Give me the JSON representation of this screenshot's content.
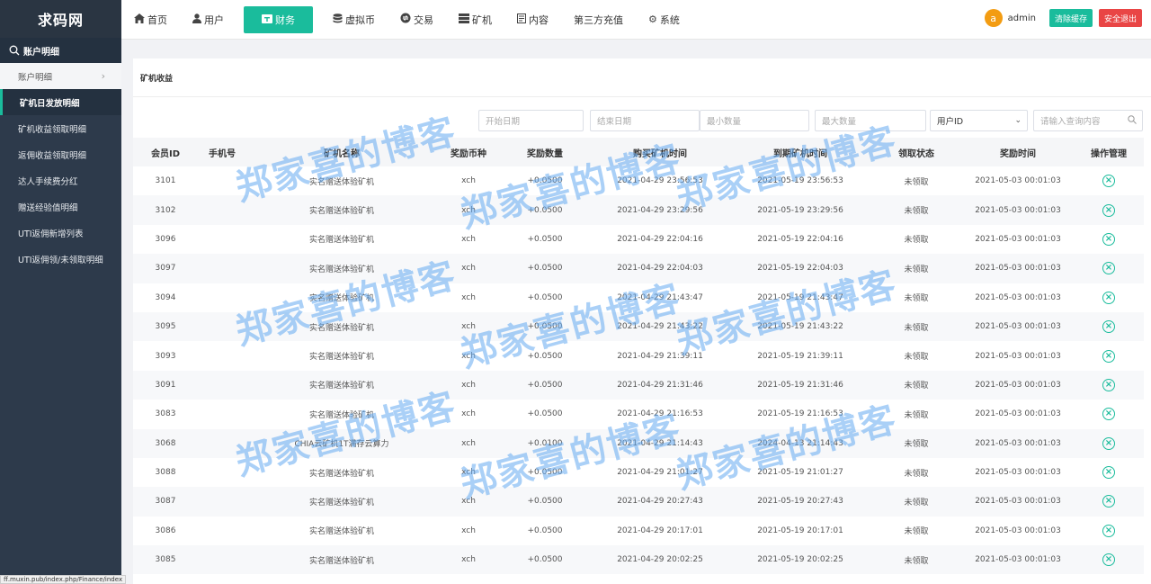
{
  "app": {
    "logo": "求码网"
  },
  "sidebar": {
    "group_label": "账户明细",
    "items": [
      {
        "label": "账户明细"
      },
      {
        "label": "矿机日发放明细"
      },
      {
        "label": "矿机收益领取明细"
      },
      {
        "label": "返佣收益领取明细"
      },
      {
        "label": "达人手续费分红"
      },
      {
        "label": "赠送经验值明细"
      },
      {
        "label": "UTI返佣新增列表"
      },
      {
        "label": "UTI返佣领/未领取明细"
      }
    ]
  },
  "nav": {
    "items": [
      {
        "label": "首页",
        "icon": "home-icon"
      },
      {
        "label": "用户",
        "icon": "user-icon"
      },
      {
        "label": "财务",
        "icon": "wallet-icon"
      },
      {
        "label": "虚拟币",
        "icon": "database-icon"
      },
      {
        "label": "交易",
        "icon": "exchange-icon"
      },
      {
        "label": "矿机",
        "icon": "server-icon"
      },
      {
        "label": "内容",
        "icon": "document-icon"
      },
      {
        "label": "第三方充值",
        "icon": ""
      },
      {
        "label": "系统",
        "icon": "gear-icon"
      }
    ],
    "active_index": 2
  },
  "user": {
    "avatar_letter": "a",
    "name": "admin"
  },
  "buttons": {
    "clear_cache": "清除缓存",
    "logout": "安全退出"
  },
  "panel": {
    "title": "矿机收益"
  },
  "filters": {
    "start_date": "开始日期",
    "end_date": "结束日期",
    "min_amount": "最小数量",
    "max_amount": "最大数量",
    "field_select": "用户ID",
    "search_placeholder": "请输入查询内容"
  },
  "table": {
    "headers": [
      "会员ID",
      "手机号",
      "矿机名称",
      "奖励币种",
      "奖励数量",
      "购买矿机时间",
      "到期矿机时间",
      "领取状态",
      "奖励时间",
      "操作管理"
    ],
    "rows": [
      [
        "3101",
        "",
        "实名赠送体验矿机",
        "xch",
        "+0.0500",
        "2021-04-29 23:56:53",
        "2021-05-19 23:56:53",
        "未领取",
        "2021-05-03 00:01:03"
      ],
      [
        "3102",
        "",
        "实名赠送体验矿机",
        "xch",
        "+0.0500",
        "2021-04-29 23:29:56",
        "2021-05-19 23:29:56",
        "未领取",
        "2021-05-03 00:01:03"
      ],
      [
        "3096",
        "",
        "实名赠送体验矿机",
        "xch",
        "+0.0500",
        "2021-04-29 22:04:16",
        "2021-05-19 22:04:16",
        "未领取",
        "2021-05-03 00:01:03"
      ],
      [
        "3097",
        "",
        "实名赠送体验矿机",
        "xch",
        "+0.0500",
        "2021-04-29 22:04:03",
        "2021-05-19 22:04:03",
        "未领取",
        "2021-05-03 00:01:03"
      ],
      [
        "3094",
        "",
        "实名赠送体验矿机",
        "xch",
        "+0.0500",
        "2021-04-29 21:43:47",
        "2021-05-19 21:43:47",
        "未领取",
        "2021-05-03 00:01:03"
      ],
      [
        "3095",
        "",
        "实名赠送体验矿机",
        "xch",
        "+0.0500",
        "2021-04-29 21:43:22",
        "2021-05-19 21:43:22",
        "未领取",
        "2021-05-03 00:01:03"
      ],
      [
        "3093",
        "",
        "实名赠送体验矿机",
        "xch",
        "+0.0500",
        "2021-04-29 21:39:11",
        "2021-05-19 21:39:11",
        "未领取",
        "2021-05-03 00:01:03"
      ],
      [
        "3091",
        "",
        "实名赠送体验矿机",
        "xch",
        "+0.0500",
        "2021-04-29 21:31:46",
        "2021-05-19 21:31:46",
        "未领取",
        "2021-05-03 00:01:03"
      ],
      [
        "3083",
        "",
        "实名赠送体验矿机",
        "xch",
        "+0.0500",
        "2021-04-29 21:16:53",
        "2021-05-19 21:16:53",
        "未领取",
        "2021-05-03 00:01:03"
      ],
      [
        "3068",
        "",
        "CHIA云矿机1T满存云算力",
        "xch",
        "+0.0100",
        "2021-04-29 21:14:43",
        "2024-04-13 21:14:43",
        "未领取",
        "2021-05-03 00:01:03"
      ],
      [
        "3088",
        "",
        "实名赠送体验矿机",
        "xch",
        "+0.0500",
        "2021-04-29 21:01:27",
        "2021-05-19 21:01:27",
        "未领取",
        "2021-05-03 00:01:03"
      ],
      [
        "3087",
        "",
        "实名赠送体验矿机",
        "xch",
        "+0.0500",
        "2021-04-29 20:27:43",
        "2021-05-19 20:27:43",
        "未领取",
        "2021-05-03 00:01:03"
      ],
      [
        "3086",
        "",
        "实名赠送体验矿机",
        "xch",
        "+0.0500",
        "2021-04-29 20:17:01",
        "2021-05-19 20:17:01",
        "未领取",
        "2021-05-03 00:01:03"
      ],
      [
        "3085",
        "",
        "实名赠送体验矿机",
        "xch",
        "+0.0500",
        "2021-04-29 20:02:25",
        "2021-05-19 20:02:25",
        "未领取",
        "2021-05-03 00:01:03"
      ]
    ]
  },
  "watermark": "郑家喜的博客",
  "status_url": "ff.muxin.pub/index.php/Finance/index",
  "colors": {
    "accent": "#1abc9c",
    "sidebar": "#2d3a4b",
    "danger": "#e94545",
    "avatar": "#f39c12"
  }
}
